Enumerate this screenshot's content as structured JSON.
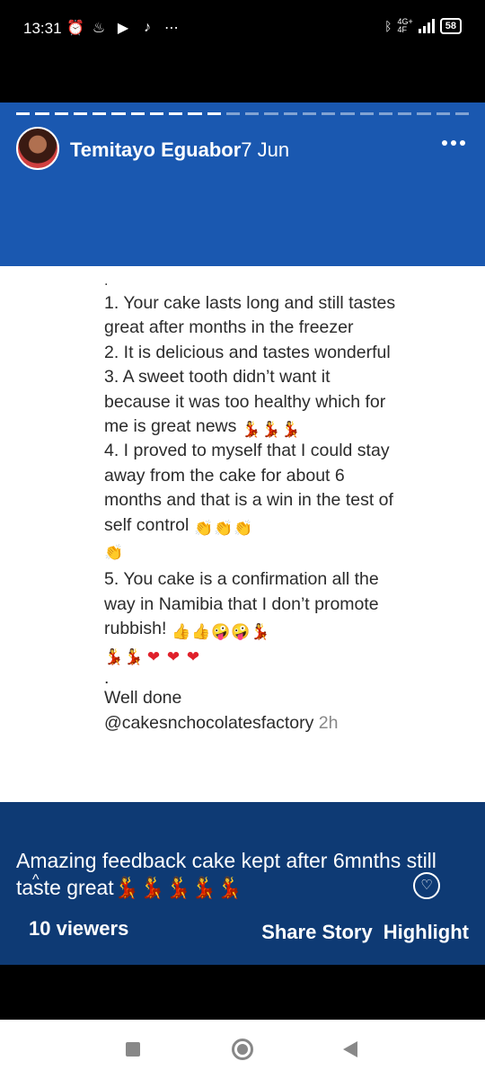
{
  "status_bar": {
    "time": "13:31",
    "network": "4G+",
    "network_sub": "4F",
    "battery": "58",
    "icons_left": [
      "alarm-icon",
      "flame-icon",
      "d-app-icon",
      "tiktok-icon",
      "more-notifications-icon"
    ],
    "icons_right": [
      "bluetooth-icon",
      "signal-icon",
      "battery-icon"
    ]
  },
  "story": {
    "poster_name": "Temitayo Eguabor",
    "posted_time": "7 Jun",
    "progress_segments_done": 11,
    "progress_segments_total": 24
  },
  "content": {
    "top_dot": ".",
    "items": [
      "1. Your cake lasts long and still tastes great after months in the freezer",
      "2. It is delicious and tastes wonderful",
      "3. A sweet tooth didn’t want it because it was too healthy which for me is great news",
      "4. I proved to myself that I could stay away from the cake for about 6 months and that is a win in the test of self control",
      "5. You cake is a confirmation all the way in Namibia that I don’t promote rubbish!"
    ],
    "mid_dot": ".",
    "sign_off": "Well done",
    "mention": "@cakesnchocolatesfactory",
    "mention_age": "2h"
  },
  "caption": {
    "text": "Amazing feedback cake kept after 6mnths still taste great",
    "chevron": "^",
    "react_icon": "heart-circle-icon"
  },
  "footer": {
    "viewers": "10 viewers",
    "share_label": "Share Story",
    "highlight_label": "Highlight"
  },
  "colors": {
    "story_header_bg": "#1a58b0",
    "story_footer_bg": "#0e3a74",
    "heart": "#e0202a"
  }
}
